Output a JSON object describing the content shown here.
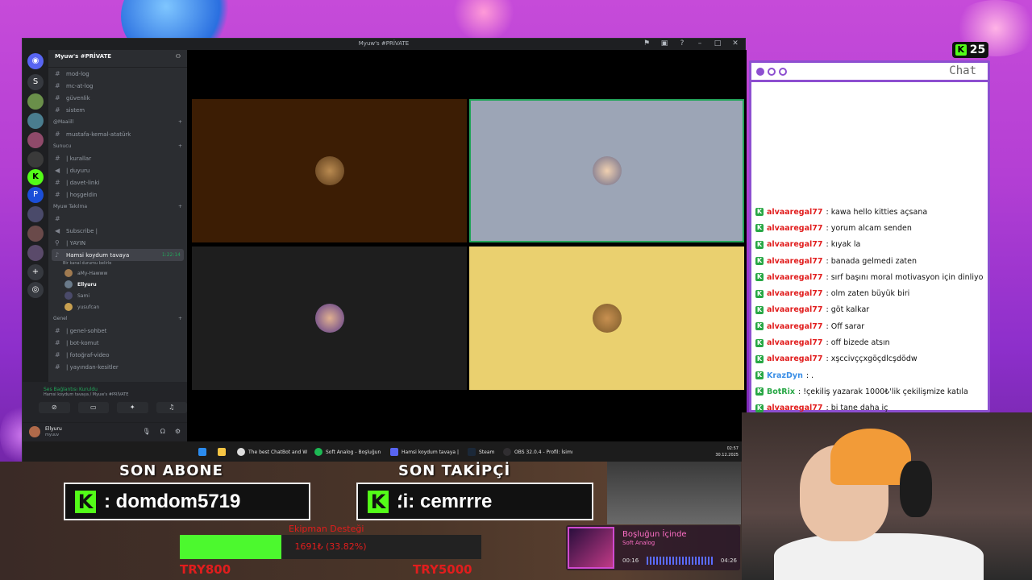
{
  "discord": {
    "window_title": "Myuw's #PRİVATE",
    "server_name": "Myuw's #PRİVATE",
    "channels_top": [
      "mod-log",
      "mc-at-log",
      "güvenlik",
      "sistem"
    ],
    "category_1": "@Maaiill",
    "channel_cat1": "mustafa-kemal-atatürk",
    "category_2": "Sunucu",
    "channels_cat2": [
      "| kurallar",
      "| duyuru",
      "| davet-linki",
      "| hoşgeldin"
    ],
    "category_3": "Myuw Takılma",
    "channels_cat3": [
      "",
      "Subscribe |",
      "| YAYIN"
    ],
    "active_voice": "Hamsi koydum tavaya",
    "active_voice_time": "1:22:14",
    "active_voice_sub": "Bir kanal durumu belirle",
    "voice_users": [
      "aMy-Hawww",
      "Ellyuru",
      "Sami",
      "yusufcan"
    ],
    "category_4": "Genel",
    "channels_cat4": [
      "| genel-sohbet",
      "| bot-komut",
      "| fotoğraf-video",
      "| yayından-kesitler"
    ],
    "voice_status": "Ses Bağlantısı Kuruldu",
    "voice_status_sub": "Hamsi koydum tavaya / Myuw's #PRİVATE",
    "user_name": "Ellyuru",
    "user_tag": "myuuv",
    "taskbar": [
      "The best ChatBot and W",
      "Soft Analog - Boşluğun",
      "Hamsi koydum tavaya |",
      "Steam",
      "OBS 32.0.4 - Profil: İsimı"
    ],
    "clock_time": "02:57",
    "clock_date": "30.12.2025"
  },
  "kick_viewers": "25",
  "chat": {
    "title": "Chat",
    "messages": [
      {
        "nick": "alvaaregal77",
        "text": ": kawa hello kitties açsana",
        "color": "#e11d1d"
      },
      {
        "nick": "alvaaregal77",
        "text": ": yorum alcam senden",
        "color": "#e11d1d"
      },
      {
        "nick": "alvaaregal77",
        "text": ": kıyak la",
        "color": "#e11d1d"
      },
      {
        "nick": "alvaaregal77",
        "text": ": banada gelmedi zaten",
        "color": "#e11d1d"
      },
      {
        "nick": "alvaaregal77",
        "text": ": sırf başını moral motivasyon için dinliyo",
        "color": "#e11d1d"
      },
      {
        "nick": "alvaaregal77",
        "text": ": olm zaten büyük biri",
        "color": "#e11d1d"
      },
      {
        "nick": "alvaaregal77",
        "text": ": göt kalkar",
        "color": "#e11d1d"
      },
      {
        "nick": "alvaaregal77",
        "text": ": Off sarar",
        "color": "#e11d1d"
      },
      {
        "nick": "alvaaregal77",
        "text": ": off bizede atsın",
        "color": "#e11d1d"
      },
      {
        "nick": "alvaaregal77",
        "text": ": xşccivççxgöçdlcşdödw",
        "color": "#e11d1d"
      },
      {
        "nick": "KrazDyn",
        "text": ": .",
        "color": "#3a8ee6"
      },
      {
        "nick": "BotRix",
        "text": ": !çekiliş yazarak 1000₺'lik çekilişmize katıla",
        "color": "#28a745"
      },
      {
        "nick": "alvaaregal77",
        "text": ": bi tane daha iç",
        "color": "#e11d1d"
      }
    ]
  },
  "overlay": {
    "last_sub_label": "SON ABONE",
    "last_sub_value": ": domdom5719",
    "last_follower_label": "SON TAKİPÇİ",
    "last_follower_value": "؛i: cemrrre",
    "donation_title": "Ekipman Desteği",
    "donation_text": "1691₺ (33.82%)",
    "donation_progress": 0.3382,
    "donation_current": "TRY800",
    "donation_goal": "TRY5000",
    "song_title": "Boşluğun İçinde",
    "song_artist": "Soft Analog",
    "song_elapsed": "00:16",
    "song_total": "04:26"
  }
}
